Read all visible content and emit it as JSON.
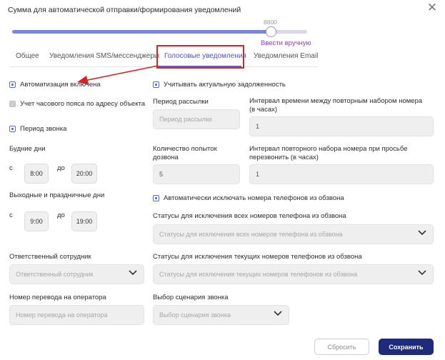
{
  "header": {
    "title": "Сумма для автоматической отправки/формирования уведомлений",
    "slider_value": "8800",
    "slider_fraction": 0.88,
    "manual_link": "Ввести вручную"
  },
  "tabs": [
    {
      "label": "Общее",
      "active": false
    },
    {
      "label": "Уведомления SMS/мессенджеры",
      "active": false
    },
    {
      "label": "Голосовые уведомления",
      "active": true
    },
    {
      "label": "Уведомления Email",
      "active": false
    }
  ],
  "left": {
    "automation_label": "Автоматизация включена",
    "automation_checked": true,
    "timezone_label": "Учет часового пояса по адресу объекта",
    "timezone_checked": false,
    "call_period_label": "Период звонка",
    "call_period_checked": true,
    "weekdays_label": "Будние дни",
    "weekday_from_prefix": "с",
    "weekday_from": "8:00",
    "weekday_to_prefix": "до",
    "weekday_to": "20:00",
    "weekends_label": "Выходные и праздничные дни",
    "weekend_from_prefix": "с",
    "weekend_from": "9:00",
    "weekend_to_prefix": "до",
    "weekend_to": "19:00",
    "responsible_label": "Ответственный сотрудник",
    "responsible_placeholder": "Ответственный сотрудник",
    "transfer_label": "Номер перевода на оператора",
    "transfer_placeholder": "Номер перевода на оператора"
  },
  "right": {
    "debt_label": "Учитывать актуальную задолженность",
    "debt_checked": true,
    "period_label": "Период рассылки",
    "period_placeholder": "Период рассылки",
    "redial_interval_label": "Интервал времени между повторным набором номера (в часах)",
    "redial_interval_value": "1",
    "attempts_label": "Количество попыток дозвона",
    "attempts_value": "5",
    "callback_interval_label": "Интервал повторного набора номера при просьбе перезвонить (в часах)",
    "callback_interval_value": "1",
    "auto_exclude_label": "Автоматически исключать номера телефонов из обзвона",
    "auto_exclude_checked": true,
    "exclude_all_label": "Статусы для исключения всех номеров телефона из обзвона",
    "exclude_all_placeholder": "Статусы для исключения всех номеров телефона из обзвона",
    "exclude_current_label": "Статусы для исключения текущих номеров телефонов из обзвона",
    "exclude_current_placeholder": "Статусы для исключения текущих номеров телефонов из обзвона",
    "scenario_label": "Выбор сценария звонка",
    "scenario_placeholder": "Выбор сценария звонка"
  },
  "footer": {
    "reset_label": "Сбросить",
    "save_label": "Сохранить"
  },
  "colors": {
    "accent": "#5b64c9",
    "annotation": "#e02020",
    "save_button": "#1e2a7a",
    "link": "#8a3fb8"
  },
  "icons": [
    "close-icon",
    "chevron-down-icon",
    "annotation-arrow"
  ]
}
